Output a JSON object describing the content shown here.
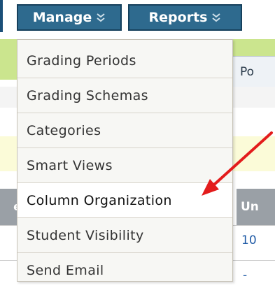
{
  "nav": {
    "manage_label": "Manage",
    "reports_label": "Reports",
    "chevron_icon": "double-chevron-down-icon"
  },
  "background": {
    "column_header_partial": "Po",
    "grid_header_right": "Un",
    "grid_header_left": "e",
    "cell_value": "10",
    "cell_dash": "-"
  },
  "menu": {
    "items": [
      {
        "label": "Grading Periods"
      },
      {
        "label": "Grading Schemas"
      },
      {
        "label": "Categories"
      },
      {
        "label": "Smart Views"
      },
      {
        "label": "Column Organization"
      },
      {
        "label": "Student Visibility"
      },
      {
        "label": "Send Email"
      }
    ]
  },
  "annotation": {
    "arrow_color": "#e31c1c",
    "points_to": "Column Organization"
  },
  "colors": {
    "nav_bg": "#2e6a8e",
    "nav_border": "#16405c",
    "band_green": "#cbe58e",
    "band_yellow": "#fbfbd8",
    "grid_header": "#9aa0a6",
    "link": "#1f5aa6"
  }
}
